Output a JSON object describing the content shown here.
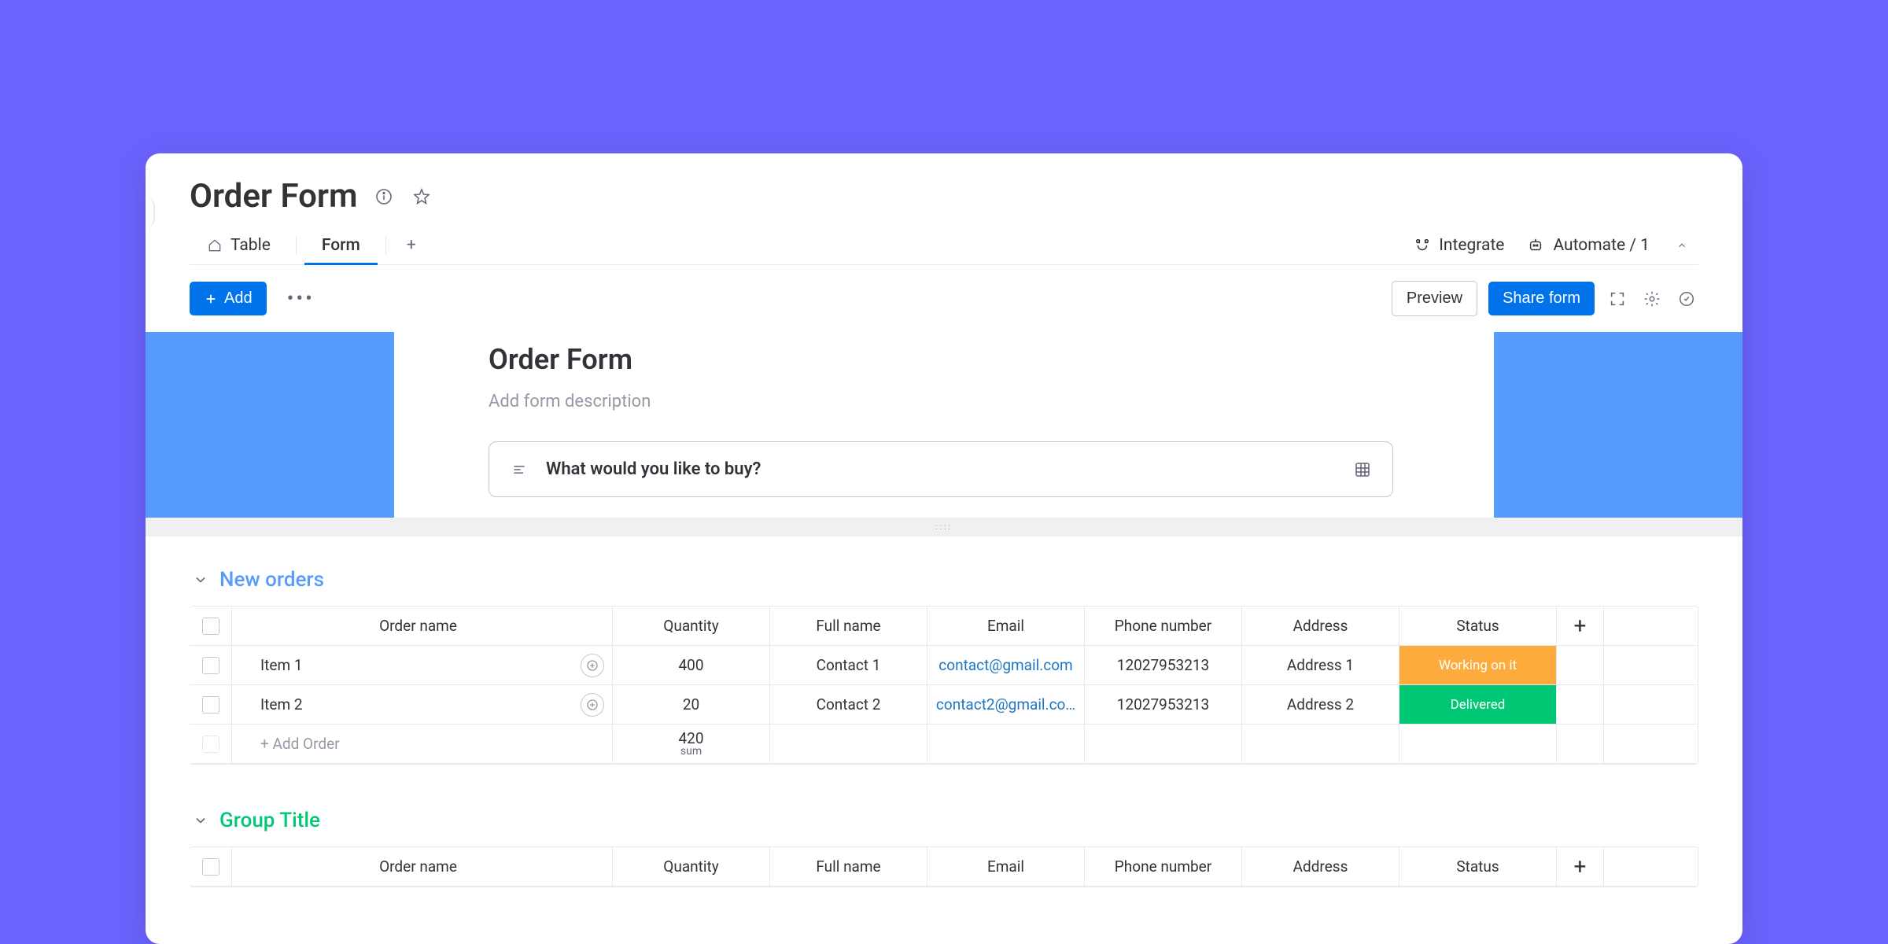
{
  "header": {
    "title": "Order Form"
  },
  "tabs": {
    "table": "Table",
    "form": "Form"
  },
  "topright": {
    "integrate": "Integrate",
    "automate": "Automate / 1"
  },
  "toolbar": {
    "add": "Add",
    "preview": "Preview",
    "share_form": "Share form"
  },
  "form_preview": {
    "title": "Order Form",
    "description_placeholder": "Add form description",
    "question": "What would you like to buy?"
  },
  "columns": {
    "order_name": "Order name",
    "quantity": "Quantity",
    "full_name": "Full name",
    "email": "Email",
    "phone": "Phone number",
    "address": "Address",
    "status": "Status"
  },
  "groups": [
    {
      "name": "New orders",
      "color": "blue",
      "rows": [
        {
          "order_name": "Item 1",
          "quantity": "400",
          "full_name": "Contact 1",
          "email": "contact@gmail.com",
          "phone": "12027953213",
          "address": "Address 1",
          "status": "Working on it",
          "status_class": "status-working"
        },
        {
          "order_name": "Item 2",
          "quantity": "20",
          "full_name": "Contact 2",
          "email": "contact2@gmail.co…",
          "phone": "12027953213",
          "address": "Address 2",
          "status": "Delivered",
          "status_class": "status-delivered"
        }
      ],
      "add_label": "+ Add Order",
      "sum_value": "420",
      "sum_label": "sum"
    },
    {
      "name": "Group Title",
      "color": "green",
      "rows": [],
      "add_label": "",
      "sum_value": "",
      "sum_label": ""
    }
  ]
}
